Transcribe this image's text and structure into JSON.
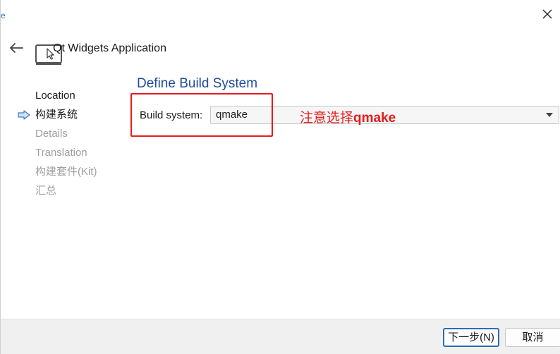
{
  "window": {
    "title": "Qt Widgets Application",
    "close_glyph": "✕",
    "back_glyph": "←"
  },
  "steps": [
    {
      "label": "Location",
      "state": "done"
    },
    {
      "label": "构建系统",
      "state": "current"
    },
    {
      "label": "Details",
      "state": "pending"
    },
    {
      "label": "Translation",
      "state": "pending"
    },
    {
      "label": "构建套件(Kit)",
      "state": "pending"
    },
    {
      "label": "汇总",
      "state": "pending"
    }
  ],
  "page": {
    "section_title": "Define Build System",
    "field_label": "Build system:",
    "build_system": {
      "selected": "qmake"
    }
  },
  "annotation": {
    "text_cn": "注意选择",
    "text_em": "qmake",
    "color": "#e51c1c"
  },
  "footer": {
    "next_label": "下一步(N)",
    "cancel_label": "取消"
  },
  "colors": {
    "accent": "#2a6db5",
    "section_title": "#1f4a9c",
    "highlight": "#e51c1c"
  },
  "icons": {
    "close": "close-icon",
    "back": "back-arrow-icon",
    "app": "qt-widgets-app-icon",
    "current_step": "current-step-arrow-icon",
    "dropdown": "chevron-down-icon"
  }
}
